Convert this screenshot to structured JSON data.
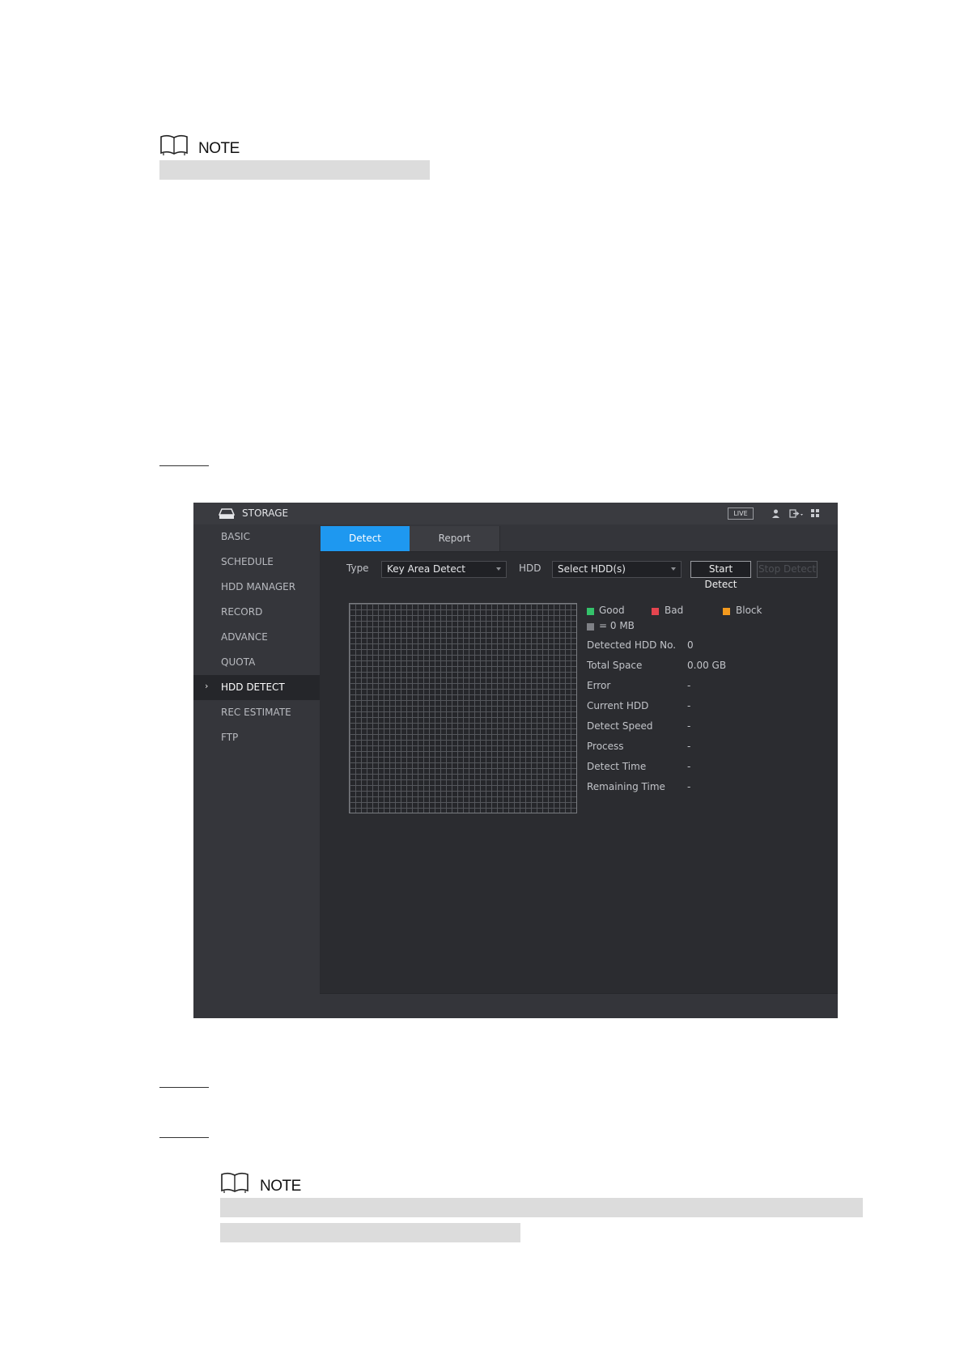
{
  "notes": [
    {
      "title": "NOTE"
    },
    {
      "title": "NOTE"
    }
  ],
  "app": {
    "title": "STORAGE",
    "live_badge": "LIVE",
    "sidebar": [
      {
        "label": "BASIC"
      },
      {
        "label": "SCHEDULE"
      },
      {
        "label": "HDD MANAGER"
      },
      {
        "label": "RECORD"
      },
      {
        "label": "ADVANCE"
      },
      {
        "label": "QUOTA"
      },
      {
        "label": "HDD DETECT",
        "active": true
      },
      {
        "label": "REC ESTIMATE"
      },
      {
        "label": "FTP"
      }
    ],
    "tabs": {
      "detect": "Detect",
      "report": "Report"
    },
    "form": {
      "type_label": "Type",
      "type_value": "Key Area Detect",
      "hdd_label": "HDD",
      "hdd_value": "Select HDD(s)",
      "start_button": "Start Detect",
      "stop_button": "Stop Detect"
    },
    "legend": {
      "good": "Good",
      "bad": "Bad",
      "block": "Block",
      "unit": "= 0 MB",
      "colors": {
        "good": "#34c26a",
        "bad": "#e5454f",
        "block": "#f39a1e",
        "unit": "#7f8186"
      }
    },
    "info": [
      {
        "label": "Detected HDD No.",
        "value": "0"
      },
      {
        "label": "Total Space",
        "value": "0.00 GB"
      },
      {
        "label": "Error",
        "value": "-"
      },
      {
        "label": "Current HDD",
        "value": "-"
      },
      {
        "label": "Detect Speed",
        "value": "-"
      },
      {
        "label": "Process",
        "value": "-"
      },
      {
        "label": "Detect Time",
        "value": "-"
      },
      {
        "label": "Remaining Time",
        "value": "-"
      }
    ],
    "accent": "#1e98f0"
  }
}
